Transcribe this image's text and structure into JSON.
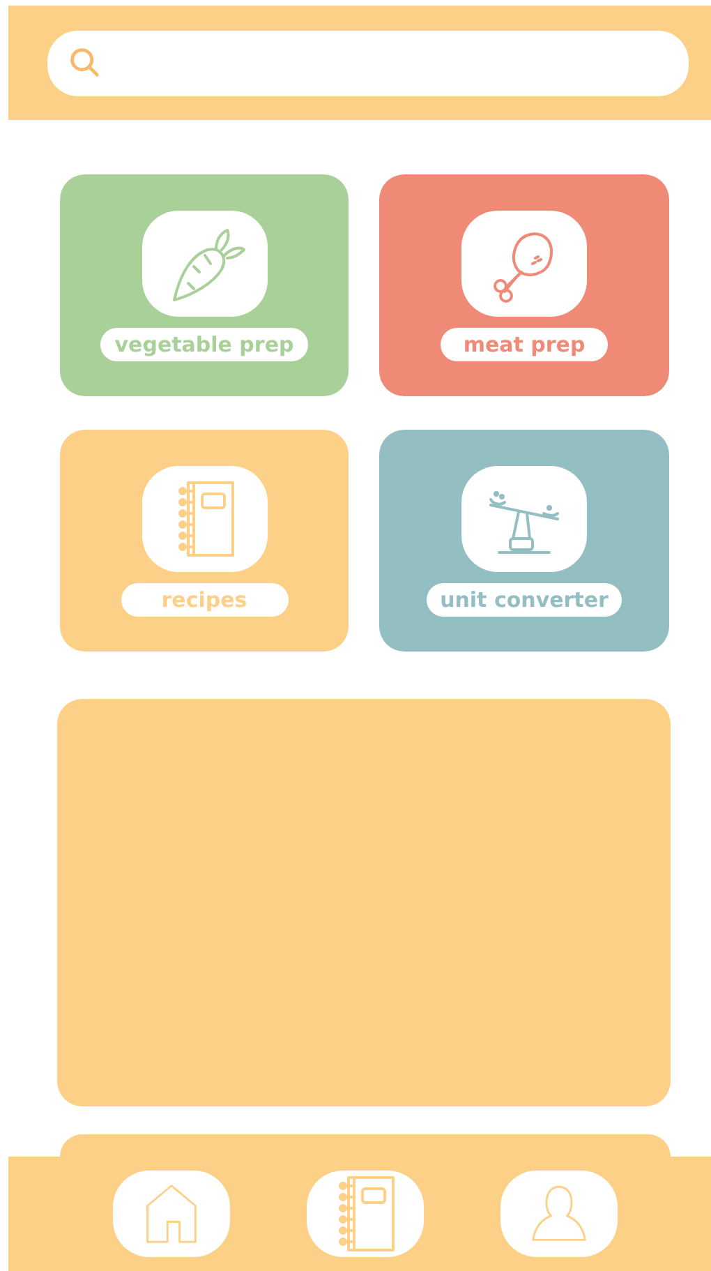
{
  "tiles": [
    {
      "label": "vegetable prep",
      "color": "#a8d098",
      "kind": "carrot"
    },
    {
      "label": "meat prep",
      "color": "#ef8a76",
      "kind": "drumstick"
    },
    {
      "label": "recipes",
      "color": "#fcd086",
      "kind": "notebook"
    },
    {
      "label": "unit converter",
      "color": "#94bfc2",
      "kind": "seesaw"
    }
  ],
  "nav": [
    {
      "kind": "home"
    },
    {
      "kind": "notebook"
    },
    {
      "kind": "person"
    }
  ]
}
